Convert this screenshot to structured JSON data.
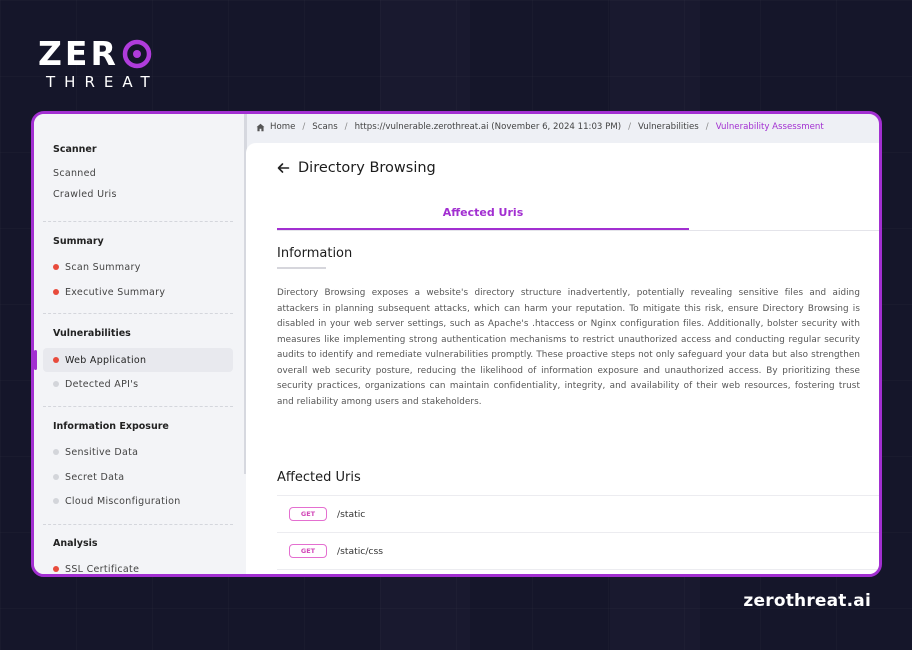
{
  "brand": {
    "logo_word_1": "ZER",
    "logo_word_2": "THREAT",
    "footer_domain": "zerothreat.ai",
    "accent_color": "#a22fd1"
  },
  "breadcrumb": {
    "items": [
      "Home",
      "Scans",
      "https://vulnerable.zerothreat.ai (November 6, 2024 11:03 PM)",
      "Vulnerabilities",
      "Vulnerability Assessment"
    ],
    "separator": "/"
  },
  "sidebar": {
    "sections": [
      {
        "heading": "Scanner",
        "items": [
          {
            "label": "Scanned"
          },
          {
            "label": "Crawled Uris"
          }
        ]
      },
      {
        "heading": "Summary",
        "items": [
          {
            "label": "Scan Summary",
            "status": "red"
          },
          {
            "label": "Executive Summary",
            "status": "red"
          }
        ]
      },
      {
        "heading": "Vulnerabilities",
        "items": [
          {
            "label": "Web Application",
            "status": "red",
            "active": true
          },
          {
            "label": "Detected API's",
            "status": "grey"
          }
        ]
      },
      {
        "heading": "Information Exposure",
        "items": [
          {
            "label": "Sensitive Data",
            "status": "grey"
          },
          {
            "label": "Secret Data",
            "status": "grey"
          },
          {
            "label": "Cloud Misconfiguration",
            "status": "grey"
          }
        ]
      },
      {
        "heading": "Analysis",
        "items": [
          {
            "label": "SSL Certificate",
            "status": "red"
          }
        ]
      }
    ]
  },
  "main": {
    "title": "Directory Browsing",
    "tab_label": "Affected Uris",
    "information_heading": "Information",
    "information_text": "Directory Browsing exposes a website's directory structure inadvertently, potentially revealing sensitive files and aiding attackers in planning subsequent attacks, which can harm your reputation. To mitigate this risk, ensure Directory Browsing is disabled in your web server settings, such as Apache's .htaccess or Nginx configuration files. Additionally, bolster security with measures like implementing strong authentication mechanisms to restrict unauthorized access and conducting regular security audits to identify and remediate vulnerabilities promptly. These proactive steps not only safeguard your data but also strengthen overall web security posture, reducing the likelihood of information exposure and unauthorized access. By prioritizing these security practices, organizations can maintain confidentiality, integrity, and availability of their web resources, fostering trust and reliability among users and stakeholders.",
    "affected_heading": "Affected Uris",
    "uris": [
      {
        "method": "GET",
        "path": "/static"
      },
      {
        "method": "GET",
        "path": "/static/css"
      }
    ]
  }
}
